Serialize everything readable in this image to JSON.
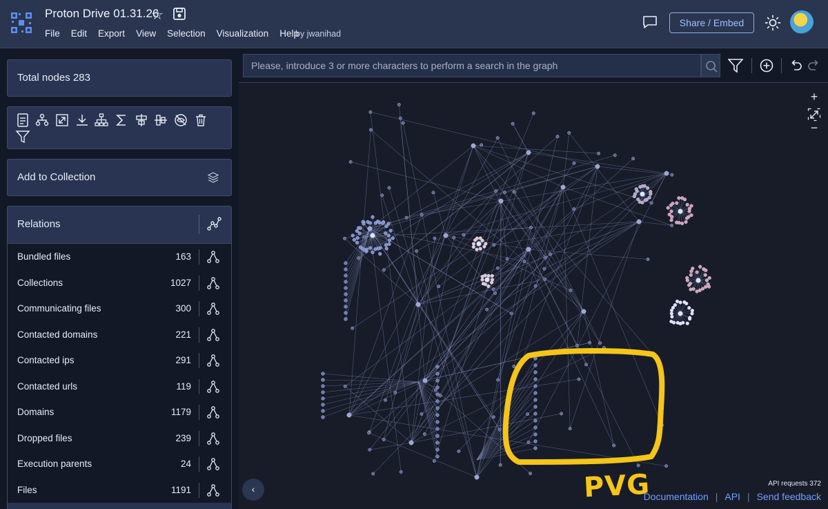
{
  "header": {
    "title": "Proton Drive 01.31.26",
    "menu": [
      "File",
      "Edit",
      "Export",
      "View",
      "Selection",
      "Visualization",
      "Help"
    ],
    "byline": "by jwanihad",
    "share_label": "Share / Embed"
  },
  "left": {
    "total_nodes": "Total nodes 283",
    "add_collection": "Add to Collection",
    "relations_title": "Relations",
    "relations": [
      {
        "label": "Bundled files",
        "count": "163"
      },
      {
        "label": "Collections",
        "count": "1027"
      },
      {
        "label": "Communicating files",
        "count": "300"
      },
      {
        "label": "Contacted domains",
        "count": "221"
      },
      {
        "label": "Contacted ips",
        "count": "291"
      },
      {
        "label": "Contacted urls",
        "count": "119"
      },
      {
        "label": "Domains",
        "count": "1179"
      },
      {
        "label": "Dropped files",
        "count": "239"
      },
      {
        "label": "Execution parents",
        "count": "24"
      },
      {
        "label": "Files",
        "count": "1191"
      }
    ]
  },
  "search": {
    "placeholder": "Please, introduce 3 or more characters to perform a search in the graph"
  },
  "graph": {
    "annotation": "PVG",
    "api_requests": "API requests 372",
    "links": [
      "Documentation",
      "API",
      "Send feedback"
    ],
    "zoom_in": "+",
    "zoom_out": "−",
    "collapse": "‹"
  },
  "icons": {
    "tools": [
      "report-icon",
      "family-tree-icon",
      "expand-icon",
      "download-icon",
      "hierarchy-icon",
      "sigma-icon",
      "align-center-icon",
      "align-middle-icon",
      "hide-icon",
      "trash-icon",
      "filter-icon"
    ],
    "accent": "#8fb0ee",
    "annotation_color": "#f5c518"
  }
}
